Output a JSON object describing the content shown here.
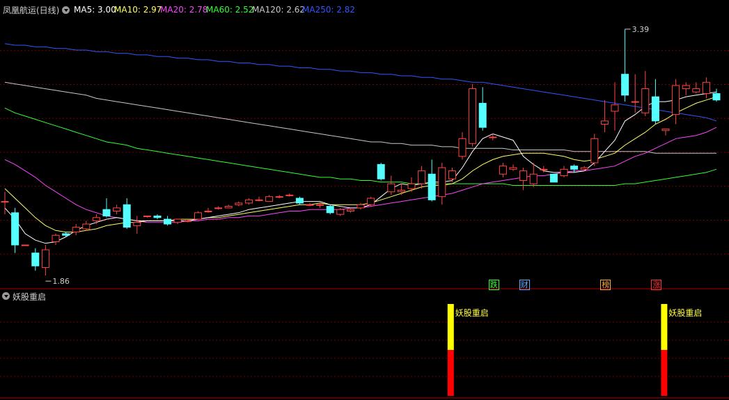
{
  "header": {
    "title": "凤凰航运(日线)",
    "ma_items": [
      {
        "label": "MA5: 3.00",
        "color": "#ffffff"
      },
      {
        "label": "MA10: 2.97",
        "color": "#ffff66"
      },
      {
        "label": "MA20: 2.78",
        "color": "#ff44ff"
      },
      {
        "label": "MA60: 2.52",
        "color": "#33ff33"
      },
      {
        "label": "MA120: 2.62",
        "color": "#c8c8c8"
      },
      {
        "label": "MA250: 2.82",
        "color": "#3355ff"
      }
    ]
  },
  "indicator": {
    "title": "妖股重启",
    "signal_label": "妖股重启"
  },
  "price_markers": {
    "high": "3.39",
    "low": "1.86"
  },
  "badges": [
    {
      "text": "跌",
      "color": "#33ff33"
    },
    {
      "text": "财",
      "color": "#66aaff"
    },
    {
      "text": "榜",
      "color": "#ffaa33"
    },
    {
      "text": "涨",
      "color": "#ff3333"
    }
  ],
  "colors": {
    "up": "#ff4444",
    "down": "#55ffff",
    "grid": "#7a0000",
    "signal_top": "#ffff00",
    "signal_bottom": "#ff0000"
  },
  "chart_data": {
    "type": "candlestick",
    "ylim": [
      1.8,
      3.45
    ],
    "candles": [
      [
        2.32,
        2.32,
        2.24,
        2.38
      ],
      [
        2.25,
        2.05,
        2.0,
        2.28
      ],
      [
        2.05,
        2.05,
        2.05,
        2.05
      ],
      [
        2.0,
        1.92,
        1.89,
        2.03
      ],
      [
        1.91,
        2.02,
        1.86,
        2.05
      ],
      [
        2.07,
        2.11,
        2.05,
        2.12
      ],
      [
        2.12,
        2.11,
        2.1,
        2.13
      ],
      [
        2.13,
        2.16,
        2.11,
        2.18
      ],
      [
        2.15,
        2.18,
        2.14,
        2.2
      ],
      [
        2.2,
        2.22,
        2.18,
        2.24
      ],
      [
        2.27,
        2.23,
        2.22,
        2.34
      ],
      [
        2.26,
        2.28,
        2.24,
        2.3
      ],
      [
        2.3,
        2.16,
        2.15,
        2.34
      ],
      [
        2.17,
        2.19,
        2.12,
        2.23
      ],
      [
        2.23,
        2.23,
        2.22,
        2.23
      ],
      [
        2.23,
        2.22,
        2.21,
        2.24
      ],
      [
        2.21,
        2.18,
        2.17,
        2.23
      ],
      [
        2.19,
        2.21,
        2.18,
        2.21
      ],
      [
        2.2,
        2.2,
        2.19,
        2.21
      ],
      [
        2.21,
        2.25,
        2.21,
        2.26
      ],
      [
        2.26,
        2.26,
        2.25,
        2.28
      ],
      [
        2.28,
        2.28,
        2.27,
        2.29
      ],
      [
        2.28,
        2.29,
        2.28,
        2.3
      ],
      [
        2.3,
        2.31,
        2.29,
        2.32
      ],
      [
        2.31,
        2.33,
        2.3,
        2.34
      ],
      [
        2.33,
        2.33,
        2.32,
        2.35
      ],
      [
        2.32,
        2.35,
        2.32,
        2.36
      ],
      [
        2.35,
        2.35,
        2.34,
        2.36
      ],
      [
        2.36,
        2.36,
        2.35,
        2.37
      ],
      [
        2.34,
        2.31,
        2.3,
        2.35
      ],
      [
        2.3,
        2.3,
        2.29,
        2.31
      ],
      [
        2.3,
        2.3,
        2.28,
        2.31
      ],
      [
        2.29,
        2.25,
        2.24,
        2.3
      ],
      [
        2.24,
        2.27,
        2.23,
        2.28
      ],
      [
        2.26,
        2.27,
        2.25,
        2.28
      ],
      [
        2.28,
        2.3,
        2.27,
        2.31
      ],
      [
        2.3,
        2.34,
        2.29,
        2.35
      ],
      [
        2.55,
        2.46,
        2.45,
        2.56
      ],
      [
        2.38,
        2.43,
        2.36,
        2.48
      ],
      [
        2.38,
        2.39,
        2.36,
        2.43
      ],
      [
        2.4,
        2.43,
        2.38,
        2.47
      ],
      [
        2.43,
        2.51,
        2.4,
        2.54
      ],
      [
        2.49,
        2.33,
        2.32,
        2.58
      ],
      [
        2.35,
        2.53,
        2.3,
        2.56
      ],
      [
        2.46,
        2.51,
        2.44,
        2.53
      ],
      [
        2.6,
        2.71,
        2.58,
        2.75
      ],
      [
        2.68,
        3.02,
        2.66,
        3.05
      ],
      [
        2.93,
        2.78,
        2.76,
        3.03
      ],
      [
        2.72,
        2.72,
        2.7,
        2.74
      ],
      [
        2.49,
        2.54,
        2.47,
        2.56
      ],
      [
        2.52,
        2.53,
        2.51,
        2.55
      ],
      [
        2.45,
        2.51,
        2.39,
        2.53
      ],
      [
        2.43,
        2.49,
        2.41,
        2.56
      ],
      [
        2.52,
        2.52,
        2.5,
        2.54
      ],
      [
        2.49,
        2.44,
        2.44,
        2.49
      ],
      [
        2.48,
        2.52,
        2.47,
        2.54
      ],
      [
        2.54,
        2.52,
        2.5,
        2.55
      ],
      [
        2.52,
        2.53,
        2.51,
        2.54
      ],
      [
        2.56,
        2.71,
        2.54,
        2.74
      ],
      [
        2.8,
        2.82,
        2.75,
        2.95
      ],
      [
        2.88,
        2.92,
        2.76,
        3.06
      ],
      [
        3.11,
        2.98,
        2.94,
        3.39
      ],
      [
        2.94,
        2.94,
        2.87,
        3.11
      ],
      [
        2.87,
        3.02,
        2.85,
        3.13
      ],
      [
        2.97,
        2.82,
        2.8,
        3.08
      ],
      [
        2.76,
        2.77,
        2.73,
        2.77
      ],
      [
        2.86,
        3.04,
        2.8,
        3.08
      ],
      [
        3.02,
        3.04,
        2.98,
        3.06
      ],
      [
        3.0,
        3.02,
        2.99,
        3.06
      ],
      [
        2.99,
        3.06,
        2.96,
        3.09
      ],
      [
        2.99,
        2.95,
        2.94,
        3.02
      ]
    ],
    "ma5": [
      2.28,
      2.21,
      2.12,
      2.08,
      2.06,
      2.07,
      2.1,
      2.14,
      2.17,
      2.19,
      2.21,
      2.22,
      2.21,
      2.2,
      2.2,
      2.2,
      2.2,
      2.2,
      2.2,
      2.21,
      2.22,
      2.23,
      2.24,
      2.25,
      2.27,
      2.28,
      2.29,
      2.3,
      2.31,
      2.32,
      2.32,
      2.32,
      2.3,
      2.29,
      2.28,
      2.28,
      2.3,
      2.35,
      2.4,
      2.43,
      2.42,
      2.43,
      2.44,
      2.44,
      2.45,
      2.53,
      2.63,
      2.71,
      2.74,
      2.72,
      2.7,
      2.6,
      2.55,
      2.51,
      2.5,
      2.5,
      2.5,
      2.51,
      2.56,
      2.63,
      2.7,
      2.82,
      2.86,
      2.91,
      2.94,
      2.94,
      2.95,
      2.97,
      2.98,
      2.99,
      3.0
    ],
    "ma10": [
      2.4,
      2.34,
      2.28,
      2.22,
      2.17,
      2.14,
      2.13,
      2.13,
      2.14,
      2.15,
      2.17,
      2.18,
      2.19,
      2.19,
      2.2,
      2.2,
      2.2,
      2.21,
      2.21,
      2.21,
      2.22,
      2.22,
      2.23,
      2.24,
      2.25,
      2.26,
      2.27,
      2.28,
      2.29,
      2.3,
      2.3,
      2.31,
      2.3,
      2.3,
      2.3,
      2.3,
      2.31,
      2.33,
      2.35,
      2.37,
      2.39,
      2.41,
      2.42,
      2.42,
      2.43,
      2.46,
      2.51,
      2.55,
      2.58,
      2.6,
      2.61,
      2.62,
      2.62,
      2.62,
      2.61,
      2.6,
      2.58,
      2.57,
      2.58,
      2.6,
      2.62,
      2.67,
      2.71,
      2.75,
      2.8,
      2.83,
      2.87,
      2.9,
      2.93,
      2.95,
      2.97
    ],
    "ma20": [
      2.58,
      2.55,
      2.51,
      2.47,
      2.42,
      2.38,
      2.34,
      2.3,
      2.27,
      2.25,
      2.23,
      2.22,
      2.21,
      2.2,
      2.19,
      2.19,
      2.19,
      2.19,
      2.2,
      2.2,
      2.21,
      2.21,
      2.22,
      2.22,
      2.23,
      2.23,
      2.24,
      2.25,
      2.26,
      2.26,
      2.27,
      2.27,
      2.27,
      2.27,
      2.28,
      2.28,
      2.29,
      2.3,
      2.31,
      2.32,
      2.33,
      2.34,
      2.35,
      2.36,
      2.37,
      2.39,
      2.41,
      2.43,
      2.44,
      2.45,
      2.46,
      2.47,
      2.48,
      2.48,
      2.49,
      2.5,
      2.51,
      2.51,
      2.52,
      2.53,
      2.54,
      2.57,
      2.6,
      2.62,
      2.65,
      2.68,
      2.71,
      2.72,
      2.73,
      2.75,
      2.78
    ],
    "ma60": [
      2.9,
      2.87,
      2.85,
      2.83,
      2.81,
      2.79,
      2.77,
      2.75,
      2.73,
      2.71,
      2.69,
      2.68,
      2.67,
      2.65,
      2.64,
      2.63,
      2.62,
      2.61,
      2.6,
      2.59,
      2.58,
      2.57,
      2.56,
      2.55,
      2.54,
      2.53,
      2.52,
      2.51,
      2.5,
      2.49,
      2.48,
      2.47,
      2.47,
      2.46,
      2.46,
      2.45,
      2.45,
      2.44,
      2.44,
      2.44,
      2.43,
      2.43,
      2.43,
      2.43,
      2.43,
      2.43,
      2.43,
      2.43,
      2.43,
      2.43,
      2.42,
      2.42,
      2.42,
      2.42,
      2.42,
      2.42,
      2.42,
      2.42,
      2.42,
      2.42,
      2.42,
      2.43,
      2.43,
      2.44,
      2.45,
      2.46,
      2.47,
      2.48,
      2.49,
      2.5,
      2.52
    ],
    "ma120": [
      3.06,
      3.05,
      3.04,
      3.03,
      3.02,
      3.01,
      3.0,
      2.99,
      2.98,
      2.96,
      2.95,
      2.94,
      2.93,
      2.92,
      2.91,
      2.9,
      2.89,
      2.88,
      2.87,
      2.86,
      2.85,
      2.84,
      2.83,
      2.82,
      2.81,
      2.8,
      2.79,
      2.78,
      2.77,
      2.76,
      2.75,
      2.74,
      2.73,
      2.72,
      2.71,
      2.7,
      2.69,
      2.69,
      2.68,
      2.68,
      2.67,
      2.67,
      2.67,
      2.66,
      2.66,
      2.65,
      2.65,
      2.65,
      2.65,
      2.65,
      2.64,
      2.64,
      2.64,
      2.64,
      2.64,
      2.64,
      2.63,
      2.63,
      2.63,
      2.63,
      2.63,
      2.63,
      2.63,
      2.63,
      2.62,
      2.62,
      2.62,
      2.62,
      2.62,
      2.62,
      2.62
    ],
    "ma250": [
      3.3,
      3.29,
      3.29,
      3.28,
      3.28,
      3.27,
      3.27,
      3.26,
      3.26,
      3.25,
      3.25,
      3.24,
      3.24,
      3.23,
      3.23,
      3.22,
      3.22,
      3.21,
      3.21,
      3.2,
      3.2,
      3.19,
      3.19,
      3.18,
      3.18,
      3.17,
      3.17,
      3.16,
      3.16,
      3.15,
      3.15,
      3.14,
      3.14,
      3.13,
      3.13,
      3.12,
      3.12,
      3.11,
      3.11,
      3.1,
      3.1,
      3.09,
      3.09,
      3.08,
      3.08,
      3.07,
      3.06,
      3.06,
      3.05,
      3.04,
      3.03,
      3.02,
      3.01,
      3.0,
      2.99,
      2.98,
      2.97,
      2.96,
      2.95,
      2.94,
      2.93,
      2.92,
      2.91,
      2.9,
      2.89,
      2.88,
      2.87,
      2.86,
      2.85,
      2.84,
      2.82
    ],
    "signal_indices": [
      43,
      64
    ],
    "high_index": 61,
    "low_index": 4,
    "badge_indices": [
      48,
      51,
      59,
      64
    ]
  }
}
